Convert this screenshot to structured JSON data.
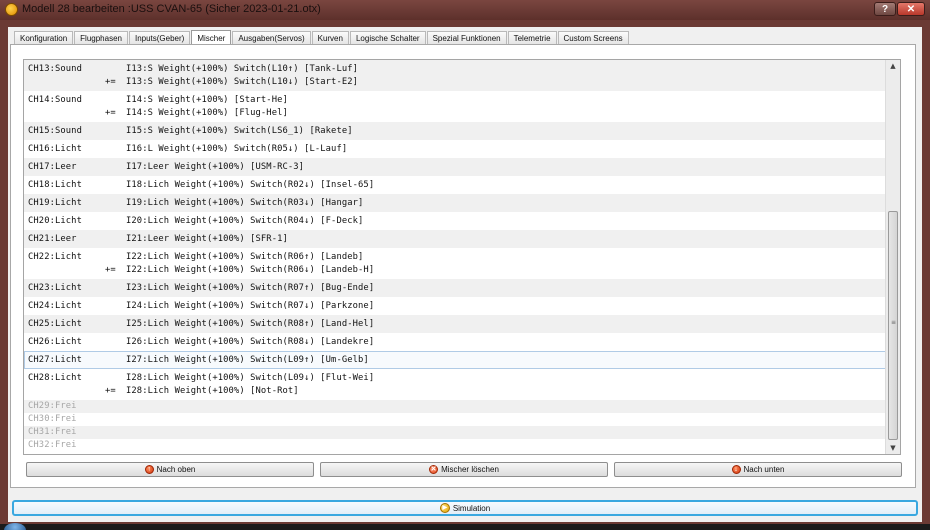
{
  "window": {
    "title": "Modell 28 bearbeiten :USS CVAN-65   (Sicher 2023-01-21.otx)",
    "help_label": "?",
    "close_label": "✕"
  },
  "tabs": [
    {
      "label": "Konfiguration"
    },
    {
      "label": "Flugphasen"
    },
    {
      "label": "Inputs(Geber)"
    },
    {
      "label": "Mischer"
    },
    {
      "label": "Ausgaben(Servos)"
    },
    {
      "label": "Kurven"
    },
    {
      "label": "Logische Schalter"
    },
    {
      "label": "Spezial Funktionen"
    },
    {
      "label": "Telemetrie"
    },
    {
      "label": "Custom Screens"
    }
  ],
  "active_tab": "Mischer",
  "mixer_list": [
    {
      "channel": "CH13:Sound",
      "lines": [
        {
          "op": "",
          "text": "I13:S Weight(+100%) Switch(L10↑) [Tank-Luf]"
        },
        {
          "op": "+=",
          "text": "I13:S Weight(+100%) Switch(L10↓) [Start-E2]"
        }
      ]
    },
    {
      "channel": "CH14:Sound",
      "lines": [
        {
          "op": "",
          "text": "I14:S Weight(+100%) [Start-He]"
        },
        {
          "op": "+=",
          "text": "I14:S Weight(+100%) [Flug-Hel]"
        }
      ]
    },
    {
      "channel": "CH15:Sound",
      "lines": [
        {
          "op": "",
          "text": "I15:S Weight(+100%) Switch(LS6_1) [Rakete]"
        }
      ]
    },
    {
      "channel": "CH16:Licht",
      "lines": [
        {
          "op": "",
          "text": "I16:L Weight(+100%) Switch(R05↓) [L-Lauf]"
        }
      ]
    },
    {
      "channel": "CH17:Leer",
      "lines": [
        {
          "op": "",
          "text": "I17:Leer Weight(+100%) [USM-RC-3]"
        }
      ]
    },
    {
      "channel": "CH18:Licht",
      "lines": [
        {
          "op": "",
          "text": "I18:Lich Weight(+100%) Switch(R02↓) [Insel-65]"
        }
      ]
    },
    {
      "channel": "CH19:Licht",
      "lines": [
        {
          "op": "",
          "text": "I19:Lich Weight(+100%) Switch(R03↓) [Hangar]"
        }
      ]
    },
    {
      "channel": "CH20:Licht",
      "lines": [
        {
          "op": "",
          "text": "I20:Lich Weight(+100%) Switch(R04↓) [F-Deck]"
        }
      ]
    },
    {
      "channel": "CH21:Leer",
      "lines": [
        {
          "op": "",
          "text": "I21:Leer Weight(+100%) [SFR-1]"
        }
      ]
    },
    {
      "channel": "CH22:Licht",
      "lines": [
        {
          "op": "",
          "text": "I22:Lich Weight(+100%) Switch(R06↑) [Landeb]"
        },
        {
          "op": "+=",
          "text": "I22:Lich Weight(+100%) Switch(R06↓) [Landeb-H]"
        }
      ]
    },
    {
      "channel": "CH23:Licht",
      "lines": [
        {
          "op": "",
          "text": "I23:Lich Weight(+100%) Switch(R07↑) [Bug-Ende]"
        }
      ]
    },
    {
      "channel": "CH24:Licht",
      "lines": [
        {
          "op": "",
          "text": "I24:Lich Weight(+100%) Switch(R07↓) [Parkzone]"
        }
      ]
    },
    {
      "channel": "CH25:Licht",
      "lines": [
        {
          "op": "",
          "text": "I25:Lich Weight(+100%) Switch(R08↑) [Land-Hel]"
        }
      ]
    },
    {
      "channel": "CH26:Licht",
      "lines": [
        {
          "op": "",
          "text": "I26:Lich Weight(+100%) Switch(R08↓) [Landekre]"
        }
      ]
    },
    {
      "channel": "CH27:Licht",
      "selected": true,
      "lines": [
        {
          "op": "",
          "text": "I27:Lich Weight(+100%) Switch(L09↑) [Um-Gelb]"
        }
      ]
    },
    {
      "channel": "CH28:Licht",
      "lines": [
        {
          "op": "",
          "text": "I28:Lich Weight(+100%) Switch(L09↓) [Flut-Wei]"
        },
        {
          "op": "+=",
          "text": "I28:Lich Weight(+100%) [Not-Rot]"
        }
      ]
    },
    {
      "channel": "CH29:Frei",
      "free": true,
      "lines": [
        {
          "op": "",
          "text": ""
        }
      ]
    },
    {
      "channel": "CH30:Frei",
      "free": true,
      "lines": [
        {
          "op": "",
          "text": ""
        }
      ]
    },
    {
      "channel": "CH31:Frei",
      "free": true,
      "lines": [
        {
          "op": "",
          "text": ""
        }
      ]
    },
    {
      "channel": "CH32:Frei",
      "free": true,
      "lines": [
        {
          "op": "",
          "text": ""
        }
      ]
    }
  ],
  "buttons": {
    "move_up": "Nach oben",
    "delete": "Mischer löschen",
    "move_down": "Nach unten",
    "simulation": "Simulation"
  },
  "scrollbar": {
    "position_fraction": 0.4
  },
  "colors": {
    "title_bar": "#6b3a34",
    "selected_row_border": "#b0cbe6",
    "simulation_border": "#3aa8e0",
    "icon_orange": "#d1360d"
  }
}
